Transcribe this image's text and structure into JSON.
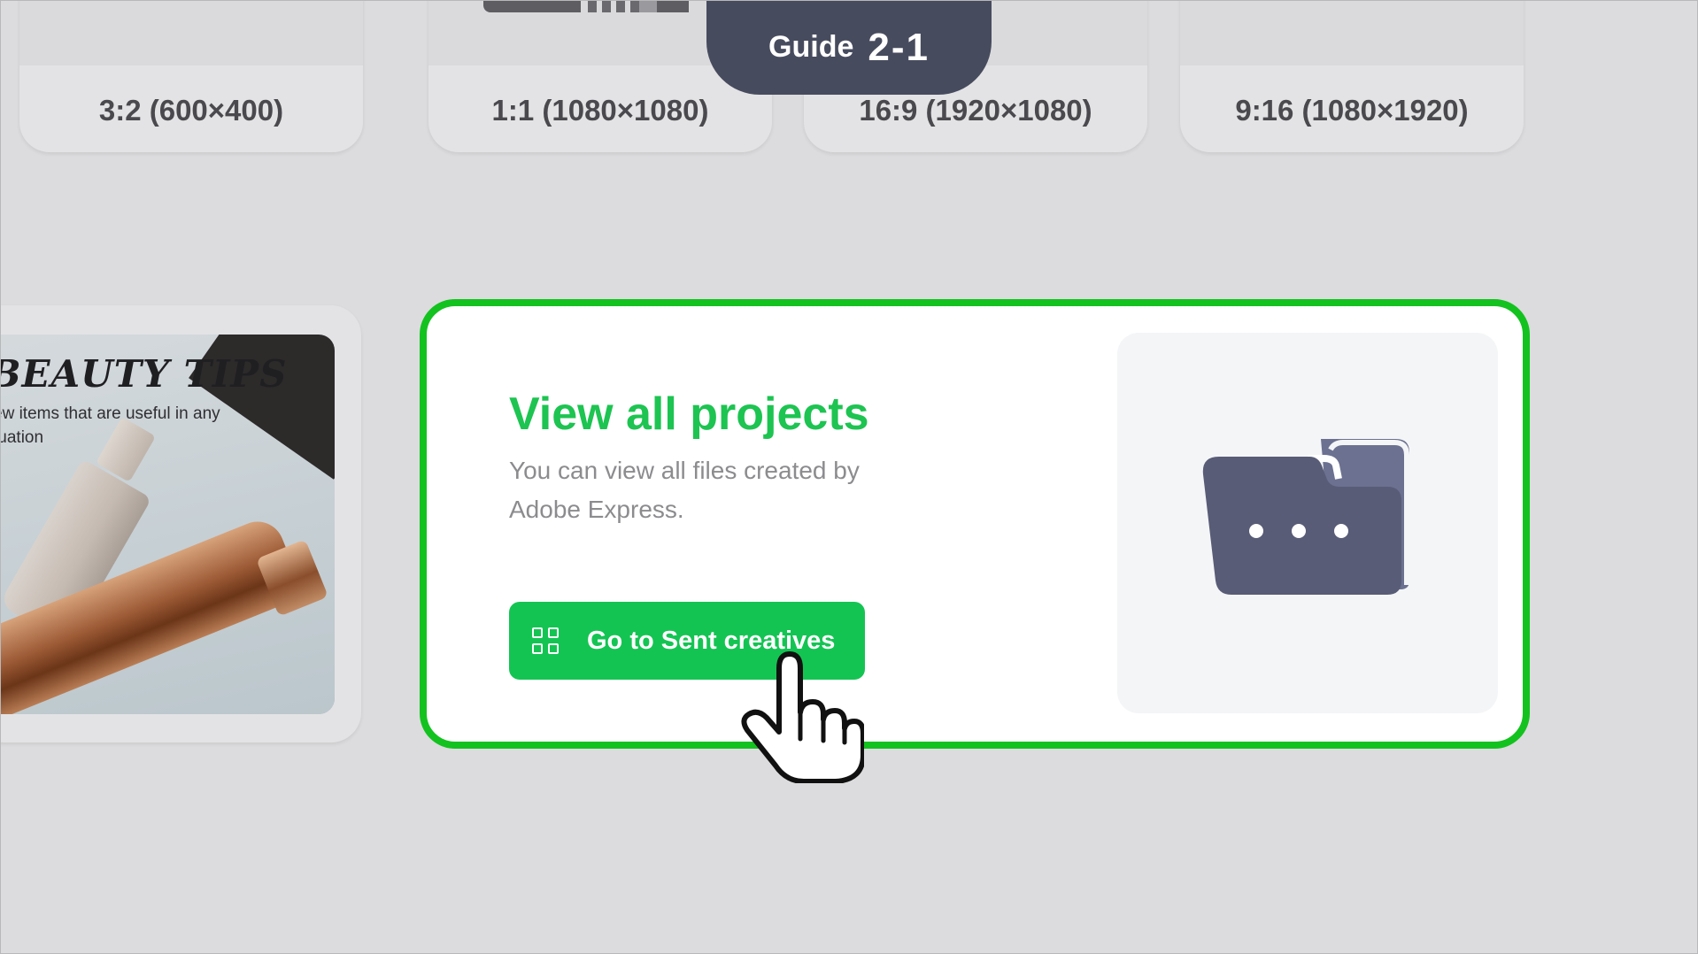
{
  "ratio_cards": [
    {
      "label": "3:2 (600×400)"
    },
    {
      "label": "1:1 (1080×1080)"
    },
    {
      "label": "16:9 (1920×1080)"
    },
    {
      "label": "9:16 (1080×1920)"
    }
  ],
  "guide_badge": {
    "word": "Guide",
    "number": "2-1"
  },
  "template": {
    "title": "BEAUTY TIPS",
    "subtitle": "ew items that are useful in any tuation"
  },
  "projects_card": {
    "title": "View all projects",
    "description": "You can view all files created by Adobe Express.",
    "button_label": "Go to Sent creatives",
    "button_icon": "grid-icon",
    "folder_icon": "folder-more-icon"
  },
  "colors": {
    "highlight_border": "#13c21f",
    "accent_green": "#14c453",
    "badge_bg": "#474b5e",
    "folder_fill": "#585c76"
  }
}
